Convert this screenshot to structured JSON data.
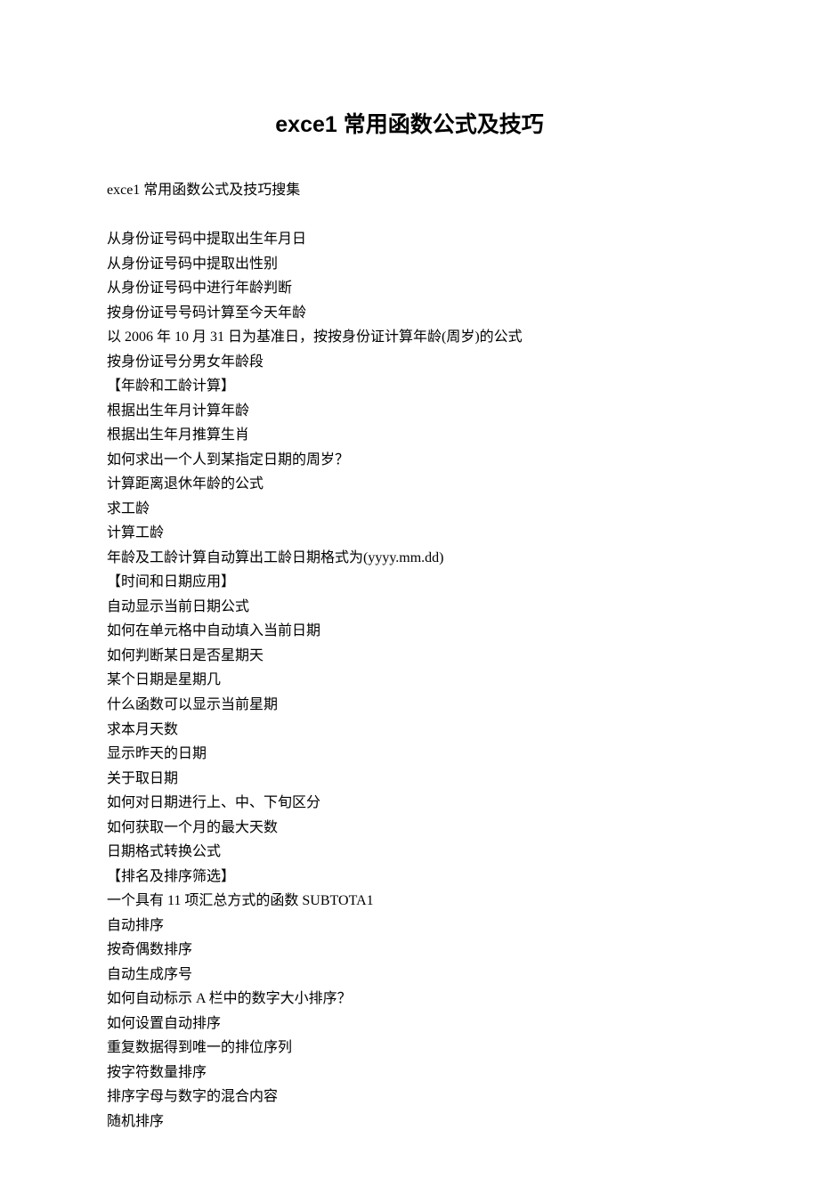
{
  "title": "exce1 常用函数公式及技巧",
  "subtitle": "exce1 常用函数公式及技巧搜集",
  "lines": [
    "从身份证号码中提取出生年月日",
    "从身份证号码中提取出性别",
    "从身份证号码中进行年龄判断",
    "按身份证号号码计算至今天年龄",
    "以 2006 年 10 月 31 日为基准日，按按身份证计算年龄(周岁)的公式",
    "按身份证号分男女年龄段",
    "【年龄和工龄计算】",
    "根据出生年月计算年龄",
    "根据出生年月推算生肖",
    "如何求出一个人到某指定日期的周岁？",
    "计算距离退休年龄的公式",
    "求工龄",
    "计算工龄",
    "年龄及工龄计算自动算出工龄日期格式为(yyyy.mm.dd)",
    "【时间和日期应用】",
    "自动显示当前日期公式",
    "如何在单元格中自动填入当前日期",
    "如何判断某日是否星期天",
    "某个日期是星期几",
    "什么函数可以显示当前星期",
    "求本月天数",
    "显示昨天的日期",
    "关于取日期",
    "如何对日期进行上、中、下旬区分",
    "如何获取一个月的最大天数",
    "日期格式转换公式",
    "【排名及排序筛选】",
    "一个具有 11 项汇总方式的函数 SUBTOTA1",
    "自动排序",
    "按奇偶数排序",
    "自动生成序号",
    "如何自动标示 A 栏中的数字大小排序？",
    "如何设置自动排序",
    "重复数据得到唯一的排位序列",
    "按字符数量排序",
    "排序字母与数字的混合内容",
    "随机排序"
  ]
}
